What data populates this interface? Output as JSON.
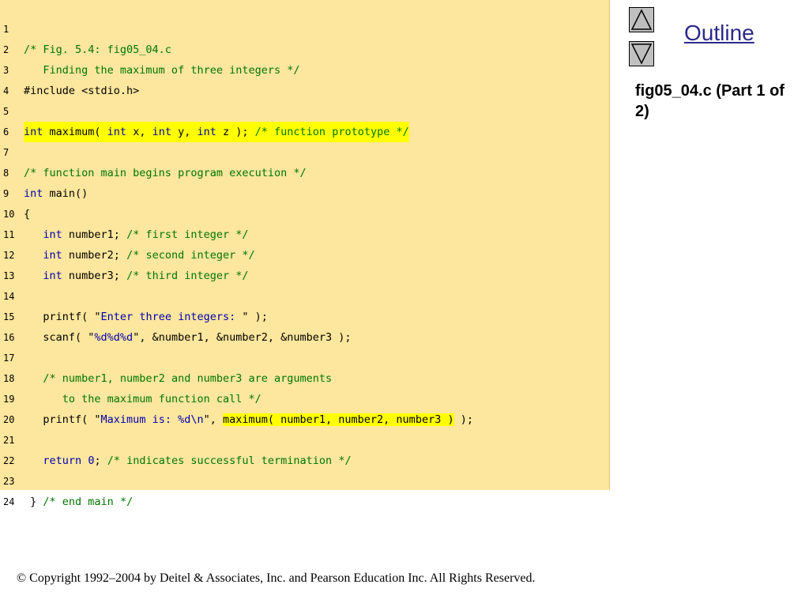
{
  "outline": {
    "title": "Outline",
    "up_icon": "triangle-up-icon",
    "down_icon": "triangle-down-icon"
  },
  "fig_label": "fig05_04.c (Part 1 of 2)",
  "copyright": "© Copyright 1992–2004 by Deitel & Associates, Inc. and Pearson Education Inc. All Rights Reserved.",
  "colors": {
    "panel": "#fde69d",
    "comment": "#007700",
    "keyword": "#0000b0",
    "highlight": "#ffff00"
  },
  "code": {
    "line_numbers": [
      "1",
      "2",
      "3",
      "4",
      "5",
      "6",
      "7",
      "8",
      "9",
      "10",
      "11",
      "12",
      "13",
      "14",
      "15",
      "16",
      "17",
      "18",
      "19",
      "20",
      "21",
      "22",
      "23",
      "24"
    ],
    "l1": "/* Fig. 5.4: fig05_04.c",
    "l2": "   Finding the maximum of three integers */",
    "l3_directive": "#include",
    "l3_header": " <stdio.h>",
    "l5_kw1": "int",
    "l5_text1": " maximum( ",
    "l5_kw2": "int",
    "l5_text2": " x, ",
    "l5_kw3": "int",
    "l5_text3": " y, ",
    "l5_kw4": "int",
    "l5_text4": " z ); ",
    "l5_comment": "/* function prototype */",
    "l7": "/* function main begins program execution */",
    "l8_kw": "int",
    "l8_text": " main()",
    "l9": "{",
    "l10_kw": "int",
    "l10_text": " number1; ",
    "l10_comment": "/* first integer */",
    "l11_kw": "int",
    "l11_text": " number2; ",
    "l11_comment": "/* second integer */",
    "l12_kw": "int",
    "l12_text": " number3; ",
    "l12_comment": "/* third integer */",
    "l14_text1": "printf( \"",
    "l14_str": "Enter three integers: ",
    "l14_text2": "\" );",
    "l15_text1": "scanf( \"",
    "l15_str": "%d%d%d",
    "l15_text2": "\", &number1, &number2, &number3 );",
    "l17": "/* number1, number2 and number3 are arguments",
    "l18": "   to the maximum function call */",
    "l19_text1": "printf( \"",
    "l19_str": "Maximum is: %d\\n",
    "l19_text2": "\", ",
    "l19_hl": "maximum( number1, number2, number3 )",
    "l19_text3": " );",
    "l21_kw": "return",
    "l21_space": " ",
    "l21_num": "0",
    "l21_text": "; ",
    "l21_comment": "/* indicates successful termination */",
    "l23_text": "} ",
    "l23_comment": "/* end main */"
  }
}
